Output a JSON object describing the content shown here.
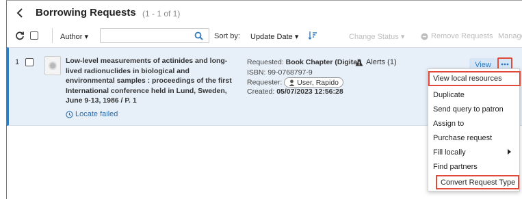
{
  "header": {
    "title": "Borrowing Requests",
    "count": "(1 - 1 of 1)"
  },
  "toolbar": {
    "filter_label": "Author ▾",
    "search_placeholder": "",
    "sort_by_label": "Sort by:",
    "sort_value": "Update Date ▾",
    "actions": {
      "change_status": "Change Status ▾",
      "remove_requests": "Remove Requests",
      "manage": "Manage"
    }
  },
  "request": {
    "number": "1",
    "title": "Low-level measurements of actinides and long-lived radionuclides in biological and environmental samples : proceedings of the first International conference held in Lund, Sweden, June 9-13, 1986 / P. 1",
    "locate_status": "Locate failed",
    "requested_label": "Requested:",
    "requested_value": "Book Chapter (Digital)",
    "isbn": "ISBN: 99-0768797-9",
    "requester_label": "Requester:",
    "requester_name": "User, Rapido",
    "created_label": "Created:",
    "created_value": "05/07/2023 12:56:28",
    "alerts": "Alerts (1)",
    "view_label": "View"
  },
  "menu": {
    "items": [
      "View local resources",
      "Duplicate",
      "Send query to patron",
      "Assign to",
      "Purchase request",
      "Fill locally",
      "Find partners",
      "Convert Request Type"
    ]
  },
  "colors": {
    "accent": "#2d7bc4",
    "highlight_box": "#e04a3b",
    "row_bg": "#e7eff8",
    "disabled": "#bdbdbd"
  },
  "icons": [
    "back-chevron-icon",
    "refresh-icon",
    "search-icon",
    "sort-direction-icon",
    "clock-icon",
    "warning-icon",
    "user-icon",
    "ellipsis-icon",
    "chevron-right-icon"
  ]
}
